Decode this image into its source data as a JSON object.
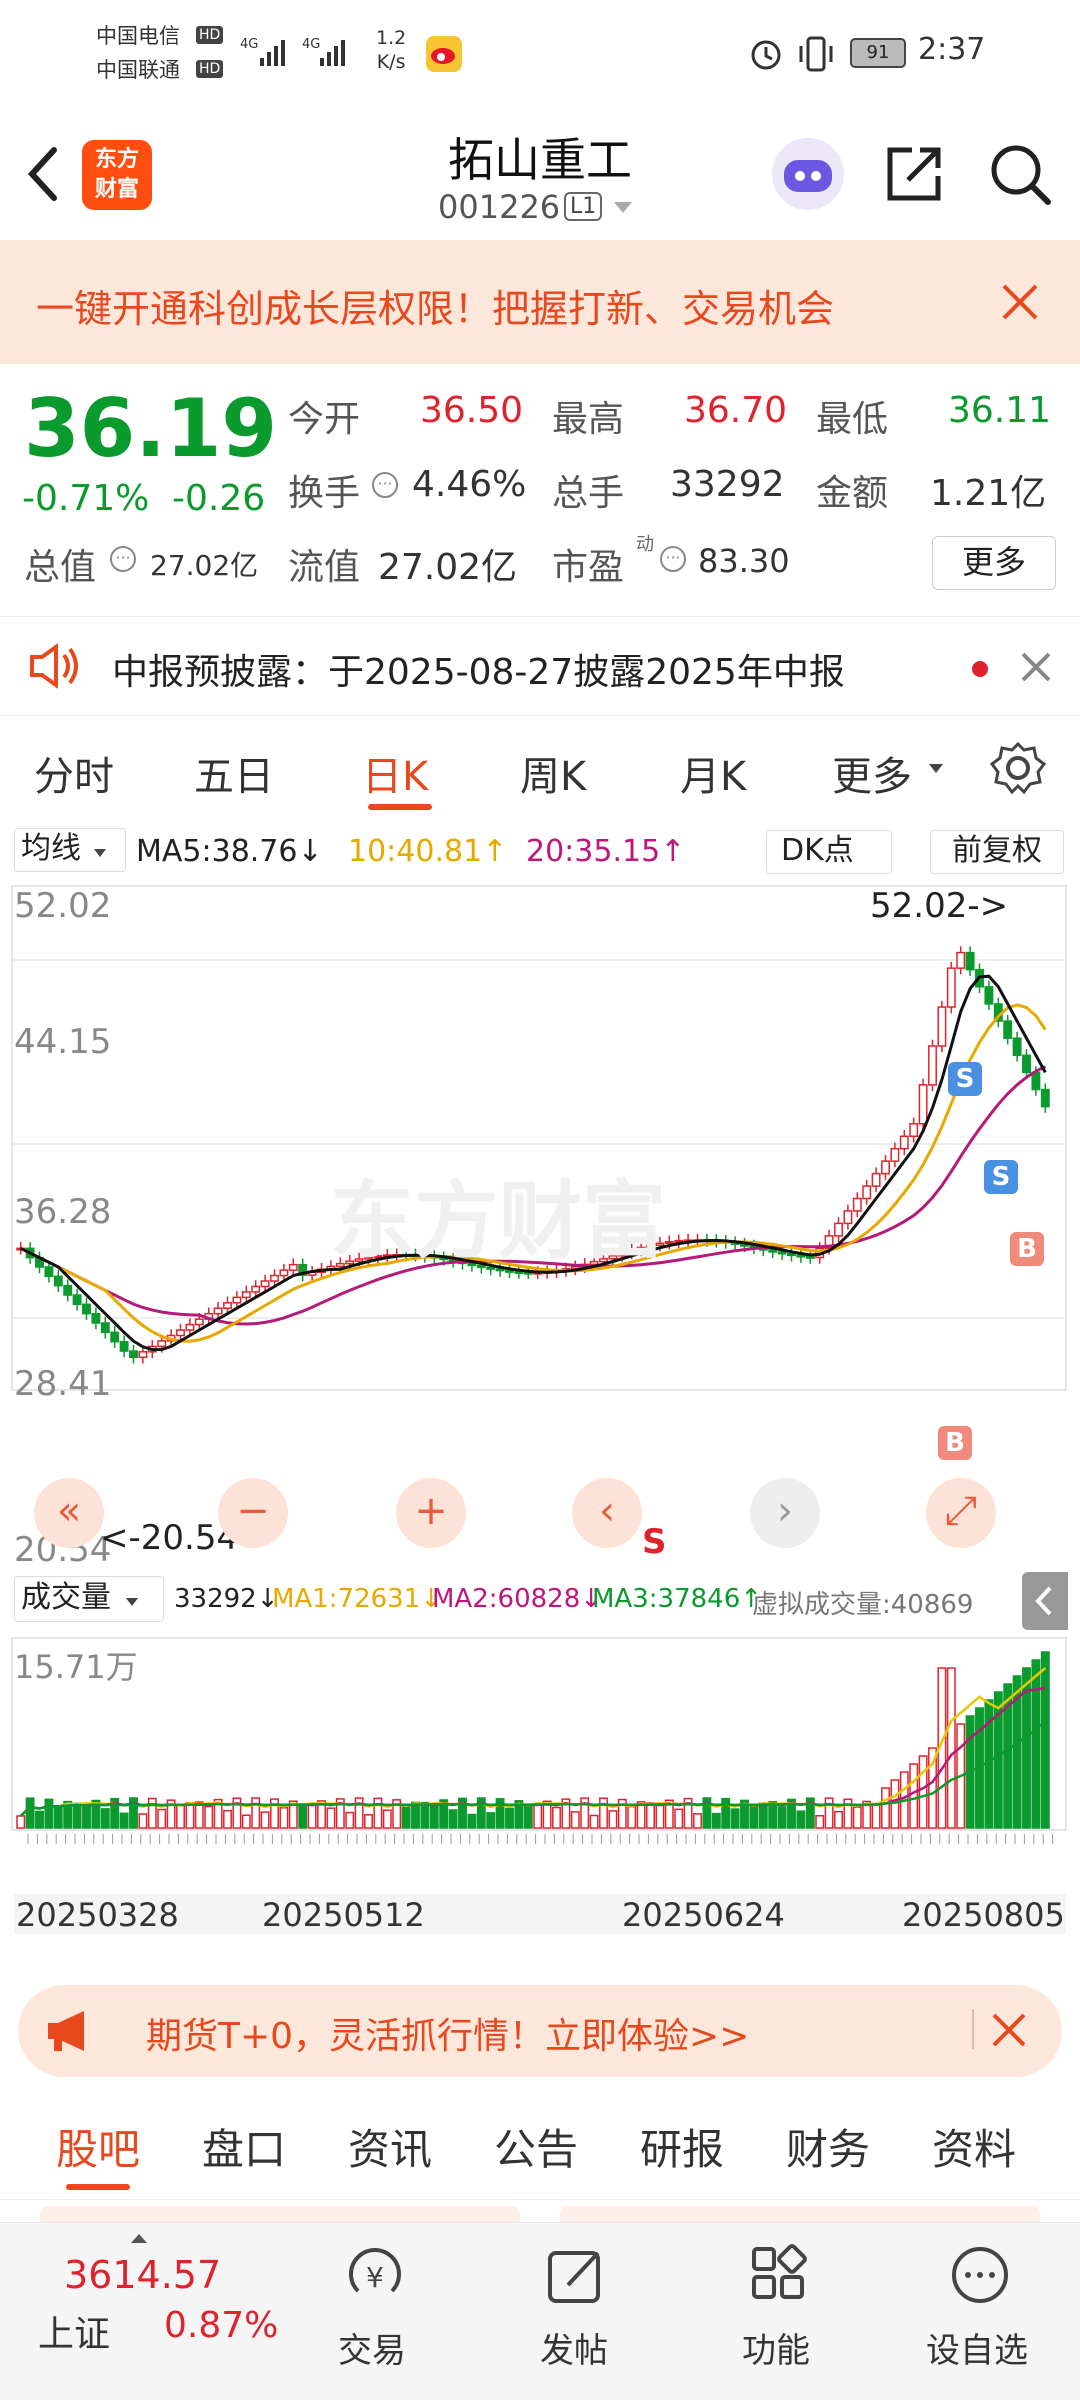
{
  "status_bar": {
    "carrier1": "中国电信",
    "carrier2": "中国联通",
    "hd": "HD",
    "net": "4G",
    "speed_value": "1.2",
    "speed_unit": "K/s",
    "battery": "91",
    "time": "2:37"
  },
  "header": {
    "title": "拓山重工",
    "code": "001226",
    "level": "L1",
    "logo_line1": "东方",
    "logo_line2": "财富"
  },
  "banner": {
    "text": "一键开通科创成长层权限！把握打新、交易机会"
  },
  "quote": {
    "price": "36.19",
    "change_pct": "-0.71%",
    "change": "-0.26",
    "open_label": "今开",
    "open": "36.50",
    "high_label": "最高",
    "high": "36.70",
    "low_label": "最低",
    "low": "36.11",
    "turnover_label": "换手",
    "turnover": "4.46%",
    "volume_label": "总手",
    "volume": "33292",
    "amount_label": "金额",
    "amount": "1.21亿",
    "mktcap_label": "总值",
    "mktcap": "27.02亿",
    "float_label": "流值",
    "float_cap": "27.02亿",
    "pe_label": "市盈",
    "pe_sup": "动",
    "pe": "83.30",
    "more": "更多"
  },
  "notice": {
    "text": "中报预披露：于2025-08-27披露2025年中报"
  },
  "tabs": [
    "分时",
    "五日",
    "日K",
    "周K",
    "月K",
    "更多"
  ],
  "active_tab": 2,
  "ma_bar": {
    "selector": "均线",
    "ma5": "MA5:38.76",
    "ma10": "10:40.81",
    "ma20": "20:35.15",
    "dk": "DK点",
    "fq": "前复权"
  },
  "kline": {
    "y_labels": [
      "52.02",
      "44.15",
      "36.28",
      "28.41",
      "20.54"
    ],
    "max_note": "52.02->",
    "min_note": "<-20.54",
    "watermark": "东方财富",
    "signal_s": "S",
    "signal_b": "B"
  },
  "vol_bar": {
    "selector": "成交量",
    "vol": "33292",
    "ma1": "MA1:72631",
    "ma2": "MA2:60828",
    "ma3": "MA3:37846",
    "virtual": "虚拟成交量:40869"
  },
  "volume_chart": {
    "max_label": "15.71万",
    "dates": [
      "20250328",
      "20250512",
      "20250624",
      "20250805"
    ]
  },
  "ad": {
    "text": "期货T+0，灵活抓行情！立即体验>>"
  },
  "bottom_tabs": [
    "股吧",
    "盘口",
    "资讯",
    "公告",
    "研报",
    "财务",
    "资料"
  ],
  "active_bottom_tab": 0,
  "bottom_bar": {
    "index_value": "3614.57",
    "index_name": "上证",
    "index_change": "0.87%",
    "trade": "交易",
    "post": "发帖",
    "func": "功能",
    "watch": "设自选"
  },
  "chart_data": {
    "type": "candlestick",
    "ylim": [
      20.54,
      52.02
    ],
    "ma_values": {
      "MA5": 38.76,
      "MA10": 40.81,
      "MA20": 35.15
    },
    "volume_ma": {
      "MA1": 72631,
      "MA2": 60828,
      "MA3": 37846
    },
    "high_extreme": 52.02,
    "low_extreme": 20.54
  }
}
